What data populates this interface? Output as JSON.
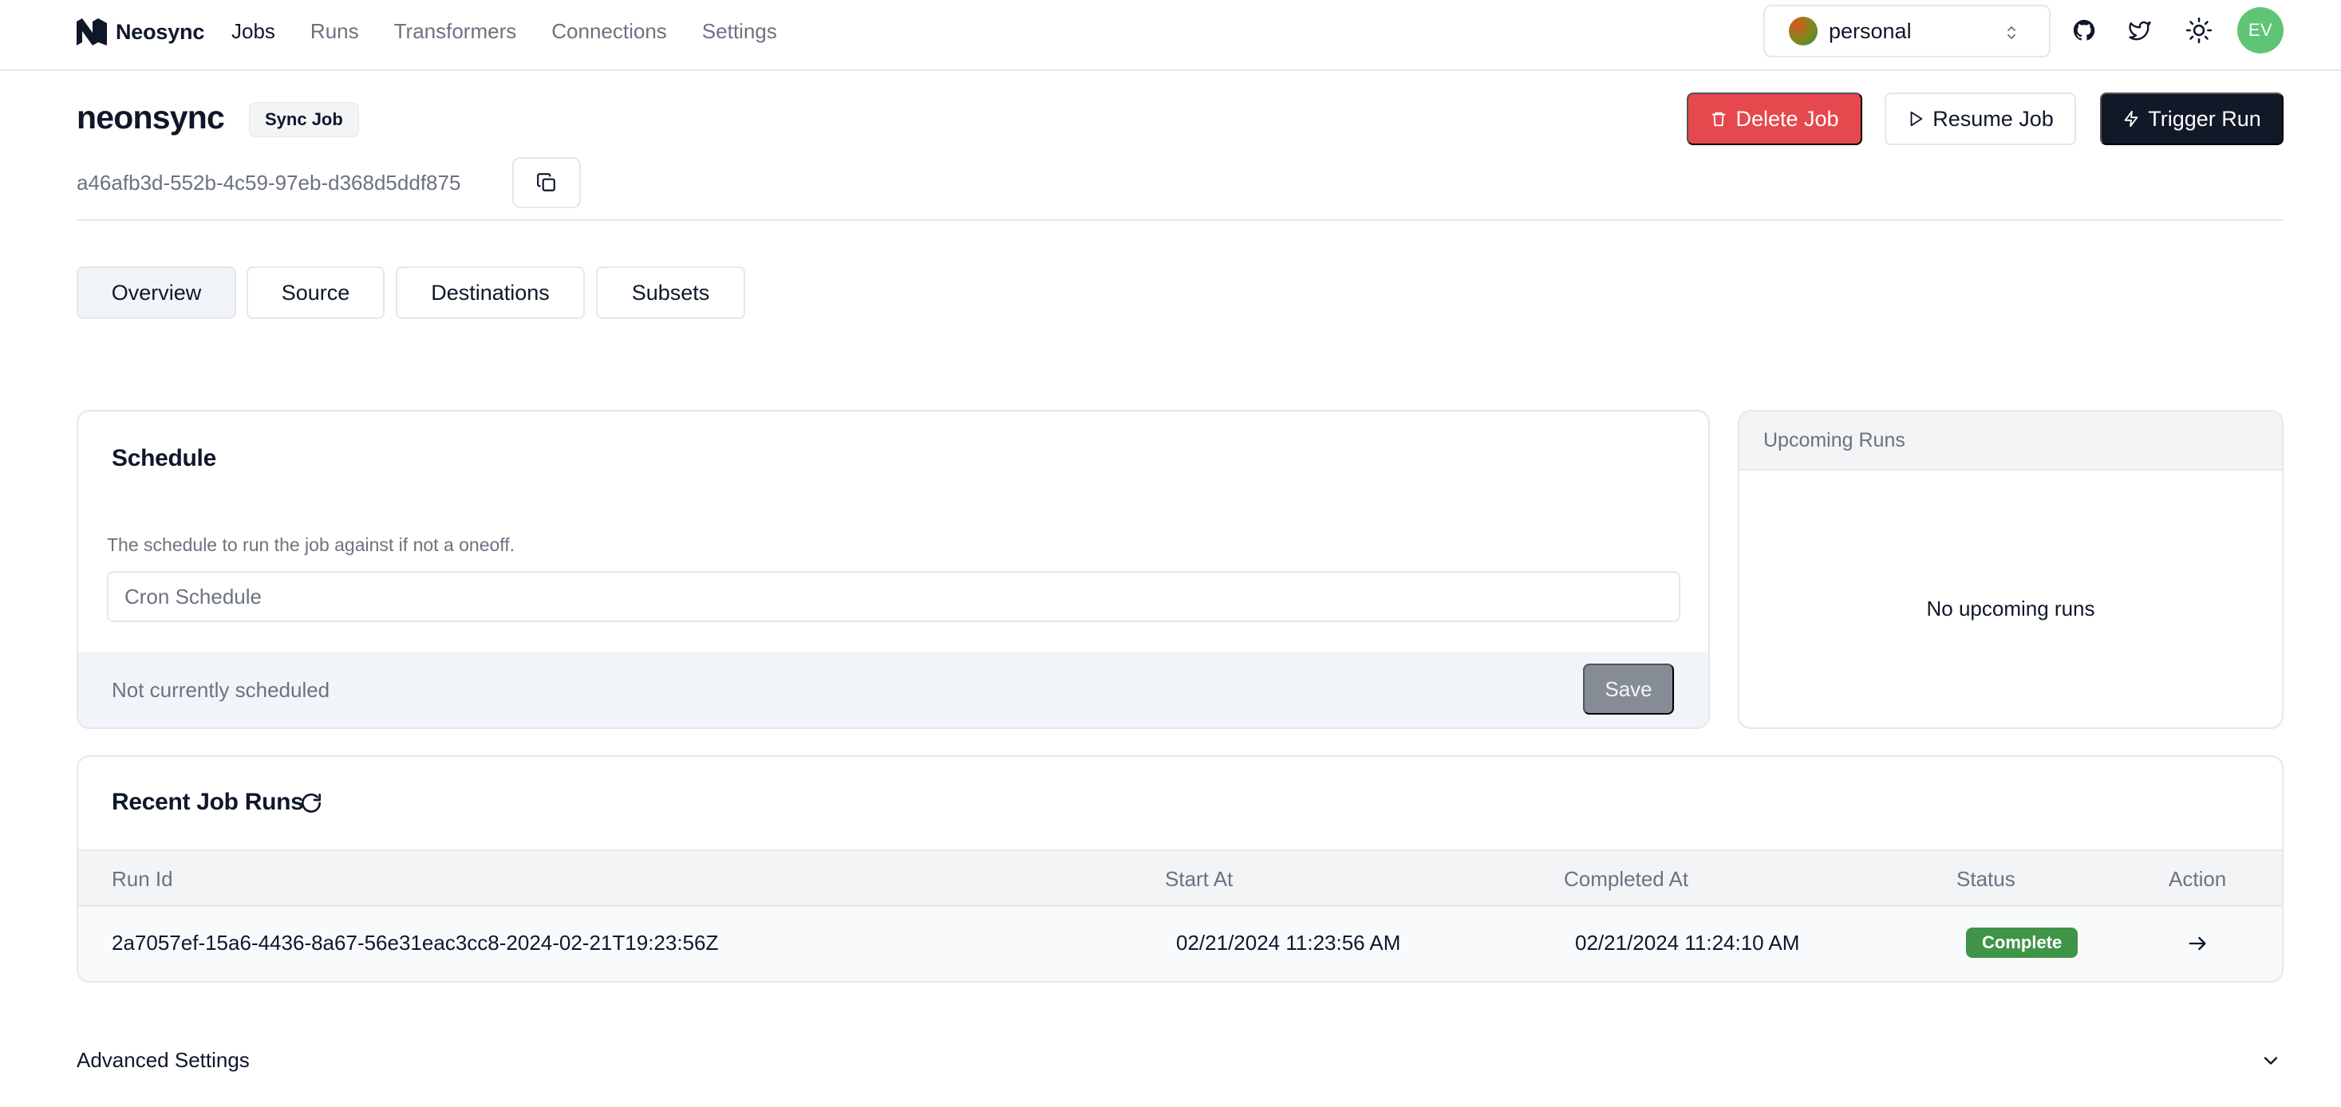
{
  "brand": {
    "name": "Neosync"
  },
  "nav": {
    "links": [
      {
        "label": "Jobs",
        "active": true
      },
      {
        "label": "Runs",
        "active": false
      },
      {
        "label": "Transformers",
        "active": false
      },
      {
        "label": "Connections",
        "active": false
      },
      {
        "label": "Settings",
        "active": false
      }
    ]
  },
  "account": {
    "name": "personal"
  },
  "user": {
    "initials": "EV"
  },
  "job": {
    "name": "neonsync",
    "type_badge": "Sync Job",
    "id": "a46afb3d-552b-4c59-97eb-d368d5ddf875"
  },
  "actions": {
    "delete_label": "Delete Job",
    "resume_label": "Resume Job",
    "trigger_label": "Trigger Run"
  },
  "tabs": [
    {
      "label": "Overview",
      "active": true
    },
    {
      "label": "Source",
      "active": false
    },
    {
      "label": "Destinations",
      "active": false
    },
    {
      "label": "Subsets",
      "active": false
    }
  ],
  "schedule": {
    "title": "Schedule",
    "description": "The schedule to run the job against if not a oneoff.",
    "cron_value": "",
    "cron_placeholder": "Cron Schedule",
    "status": "Not currently scheduled",
    "save_label": "Save"
  },
  "upcoming": {
    "title": "Upcoming Runs",
    "empty_text": "No upcoming runs"
  },
  "recent_runs": {
    "title": "Recent Job Runs",
    "columns": [
      "Run Id",
      "Start At",
      "Completed At",
      "Status",
      "Action"
    ],
    "rows": [
      {
        "run_id": "2a7057ef-15a6-4436-8a67-56e31eac3cc8-2024-02-21T19:23:56Z",
        "start_at": "02/21/2024 11:23:56 AM",
        "completed_at": "02/21/2024 11:24:10 AM",
        "status": "Complete"
      }
    ]
  },
  "advanced": {
    "title": "Advanced Settings"
  },
  "colors": {
    "primary": "#111827",
    "destructive": "#e5484d",
    "success": "#3f9447",
    "avatar": "#5fc476",
    "muted_text": "#6b7280",
    "border": "#e5e7eb"
  },
  "icons": {
    "logo": "neosync-logo",
    "github": "github-icon",
    "twitter": "twitter-icon",
    "theme": "sun-icon",
    "copy": "copy-icon",
    "delete": "trash-icon",
    "resume": "play-icon",
    "trigger": "lightning-icon",
    "refresh": "refresh-icon",
    "row_action": "arrow-right-icon",
    "expand": "chevron-down-icon"
  }
}
